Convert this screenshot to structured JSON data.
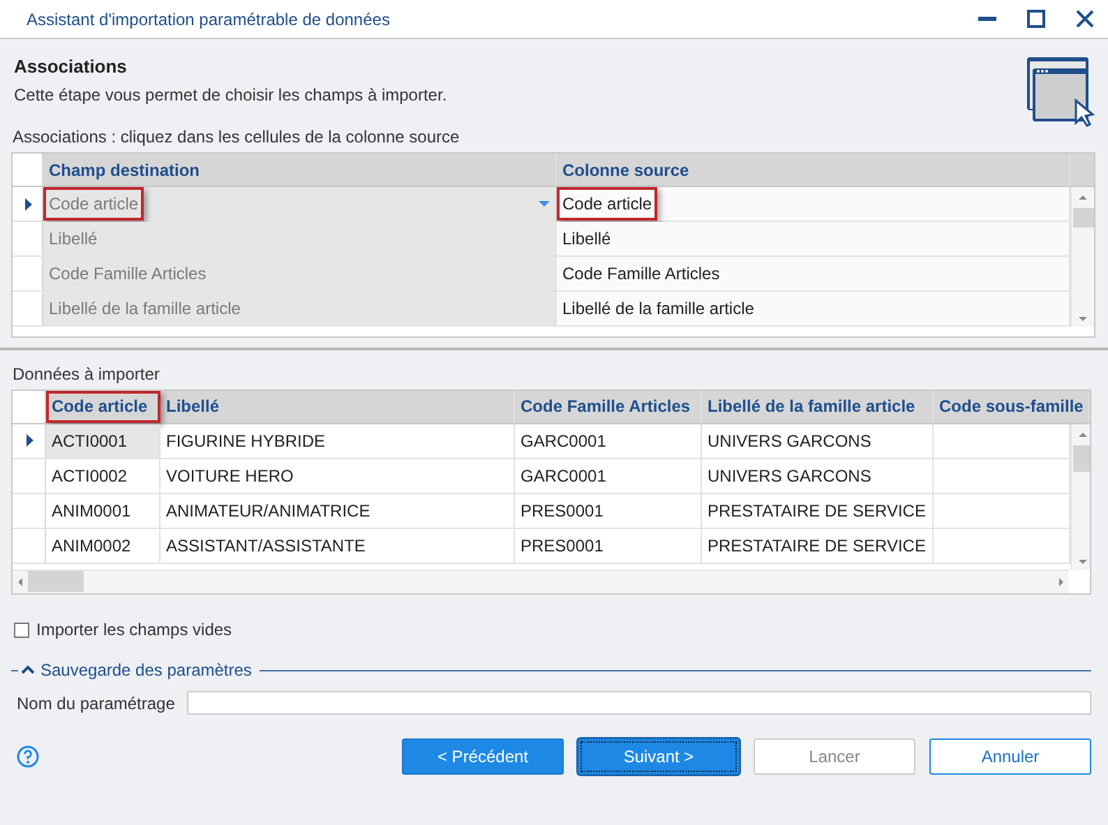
{
  "window": {
    "title": "Assistant d'importation paramétrable de données"
  },
  "header": {
    "title": "Associations",
    "subtitle": "Cette étape vous permet de choisir les champs à importer."
  },
  "associations": {
    "label": "Associations : cliquez dans les cellules de la colonne source",
    "columns": [
      "Champ destination",
      "Colonne source"
    ],
    "rows": [
      {
        "current": true,
        "cells": [
          {
            "text": "Code article",
            "highlighted": true
          },
          {
            "text": "Code article",
            "highlighted": true
          }
        ]
      },
      {
        "current": false,
        "cells": [
          {
            "text": "Libellé",
            "highlighted": false
          },
          {
            "text": "Libellé",
            "highlighted": false
          }
        ]
      },
      {
        "current": false,
        "cells": [
          {
            "text": "Code Famille Articles",
            "highlighted": false
          },
          {
            "text": "Code Famille Articles",
            "highlighted": false
          }
        ]
      },
      {
        "current": false,
        "cells": [
          {
            "text": "Libellé de la famille article",
            "highlighted": false
          },
          {
            "text": "Libellé de la famille article",
            "highlighted": false
          }
        ]
      }
    ]
  },
  "import_data": {
    "label": "Données à importer",
    "columns": [
      {
        "label": "Code article",
        "highlighted": true
      },
      {
        "label": "Libellé",
        "highlighted": false
      },
      {
        "label": "Code Famille Articles",
        "highlighted": false
      },
      {
        "label": "Libellé de la famille article",
        "highlighted": false
      },
      {
        "label": "Code sous-famille",
        "highlighted": false
      }
    ],
    "rows": [
      {
        "current": true,
        "cells": [
          "ACTI0001",
          "FIGURINE HYBRIDE",
          "GARC0001",
          "UNIVERS GARCONS"
        ]
      },
      {
        "current": false,
        "cells": [
          "ACTI0002",
          "VOITURE HERO",
          "GARC0001",
          "UNIVERS GARCONS"
        ]
      },
      {
        "current": false,
        "cells": [
          "ANIM0001",
          "ANIMATEUR/ANIMATRICE",
          "PRES0001",
          "PRESTATAIRE DE SERVICE"
        ]
      },
      {
        "current": false,
        "cells": [
          "ANIM0002",
          "ASSISTANT/ASSISTANTE",
          "PRES0001",
          "PRESTATAIRE DE SERVICE"
        ]
      }
    ]
  },
  "empty_fields_option": {
    "label": "Importer les champs vides",
    "checked": false
  },
  "settings_section": {
    "title": "Sauvegarde des paramètres",
    "expanded": true,
    "name_field": {
      "label": "Nom du paramétrage"
    }
  },
  "buttons": [
    {
      "label": "< Précédent",
      "kind": "primary",
      "focused": false,
      "disabled": false
    },
    {
      "label": "Suivant >",
      "kind": "primary",
      "focused": true,
      "disabled": false
    },
    {
      "label": "Lancer",
      "kind": "secondary",
      "focused": false,
      "disabled": true
    },
    {
      "label": "Annuler",
      "kind": "outline",
      "focused": false,
      "disabled": false
    }
  ]
}
